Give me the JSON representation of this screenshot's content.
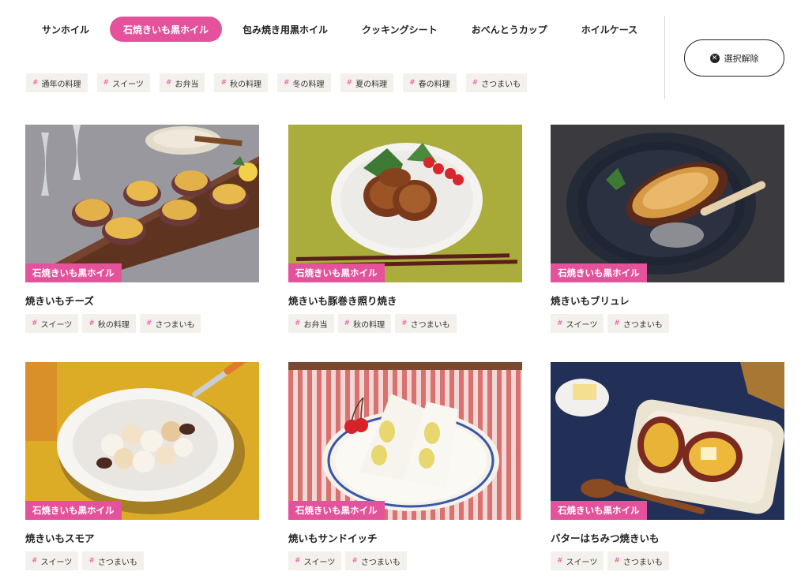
{
  "category_tabs": [
    {
      "label": "サンホイル"
    },
    {
      "label": "石焼きいも黒ホイル"
    },
    {
      "label": "包み焼き用黒ホイル"
    },
    {
      "label": "クッキングシート"
    },
    {
      "label": "おべんとうカップ"
    },
    {
      "label": "ホイルケース"
    }
  ],
  "active_tab": "石焼きいも黒ホイル",
  "clear_button_label": "選択解除",
  "filter_tags": [
    {
      "label": "通年の料理"
    },
    {
      "label": "スイーツ"
    },
    {
      "label": "お弁当"
    },
    {
      "label": "秋の料理"
    },
    {
      "label": "冬の料理"
    },
    {
      "label": "夏の料理"
    },
    {
      "label": "春の料理"
    },
    {
      "label": "さつまいも"
    }
  ],
  "hash_symbol": "#",
  "recipes": [
    {
      "category": "石焼きいも黒ホイル",
      "title": "焼きいもチーズ",
      "tags": [
        "スイーツ",
        "秋の料理",
        "さつまいも"
      ]
    },
    {
      "category": "石焼きいも黒ホイル",
      "title": "焼きいも豚巻き照り焼き",
      "tags": [
        "お弁当",
        "秋の料理",
        "さつまいも"
      ]
    },
    {
      "category": "石焼きいも黒ホイル",
      "title": "焼きいもブリュレ",
      "tags": [
        "スイーツ",
        "さつまいも"
      ]
    },
    {
      "category": "石焼きいも黒ホイル",
      "title": "焼きいもスモア",
      "tags": [
        "スイーツ",
        "さつまいも"
      ]
    },
    {
      "category": "石焼きいも黒ホイル",
      "title": "焼いもサンドイッチ",
      "tags": [
        "スイーツ",
        "さつまいも"
      ]
    },
    {
      "category": "石焼きいも黒ホイル",
      "title": "バターはちみつ焼きいも",
      "tags": [
        "スイーツ",
        "さつまいも"
      ]
    }
  ],
  "colors": {
    "accent": "#e4529b",
    "tag_bg": "#f4f1ec",
    "text": "#222222"
  }
}
